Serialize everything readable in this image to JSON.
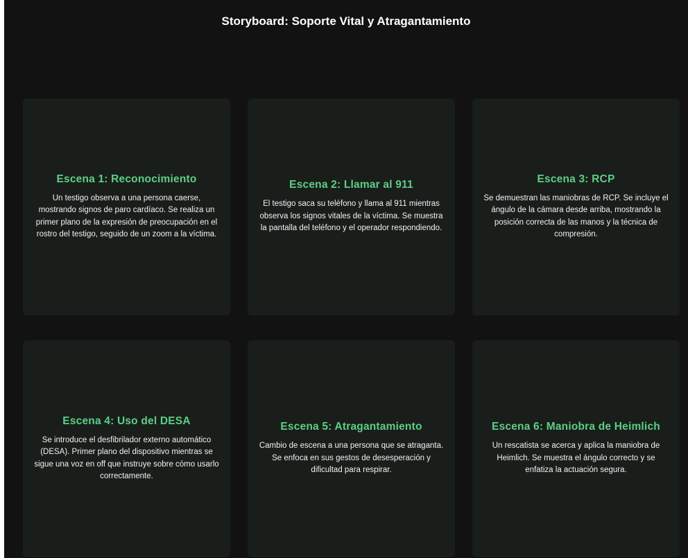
{
  "page": {
    "title": "Storyboard: Soporte Vital y Atragantamiento"
  },
  "theme": {
    "background": "#121212",
    "card_background": "#191e1b",
    "accent": "#5fce85",
    "text": "#ffffff"
  },
  "scenes": [
    {
      "title": "Escena 1: Reconocimiento",
      "description": "Un testigo observa a una persona caerse, mostrando signos de paro cardíaco. Se realiza un primer plano de la expresión de preocupación en el rostro del testigo, seguido de un zoom a la víctima."
    },
    {
      "title": "Escena 2: Llamar al 911",
      "description": "El testigo saca su teléfono y llama al 911 mientras observa los signos vitales de la víctima. Se muestra la pantalla del teléfono y el operador respondiendo."
    },
    {
      "title": "Escena 3: RCP",
      "description": "Se demuestran las maniobras de RCP. Se incluye el ángulo de la cámara desde arriba, mostrando la posición correcta de las manos y la técnica de compresión."
    },
    {
      "title": "Escena 4: Uso del DESA",
      "description": "Se introduce el desfibrilador externo automático (DESA). Primer plano del dispositivo mientras se sigue una voz en off que instruye sobre cómo usarlo correctamente."
    },
    {
      "title": "Escena 5: Atragantamiento",
      "description": "Cambio de escena a una persona que se atraganta. Se enfoca en sus gestos de desesperación y dificultad para respirar."
    },
    {
      "title": "Escena 6: Maniobra de Heimlich",
      "description": "Un rescatista se acerca y aplica la maniobra de Heimlich. Se muestra el ángulo correcto y se enfatiza la actuación segura."
    }
  ]
}
